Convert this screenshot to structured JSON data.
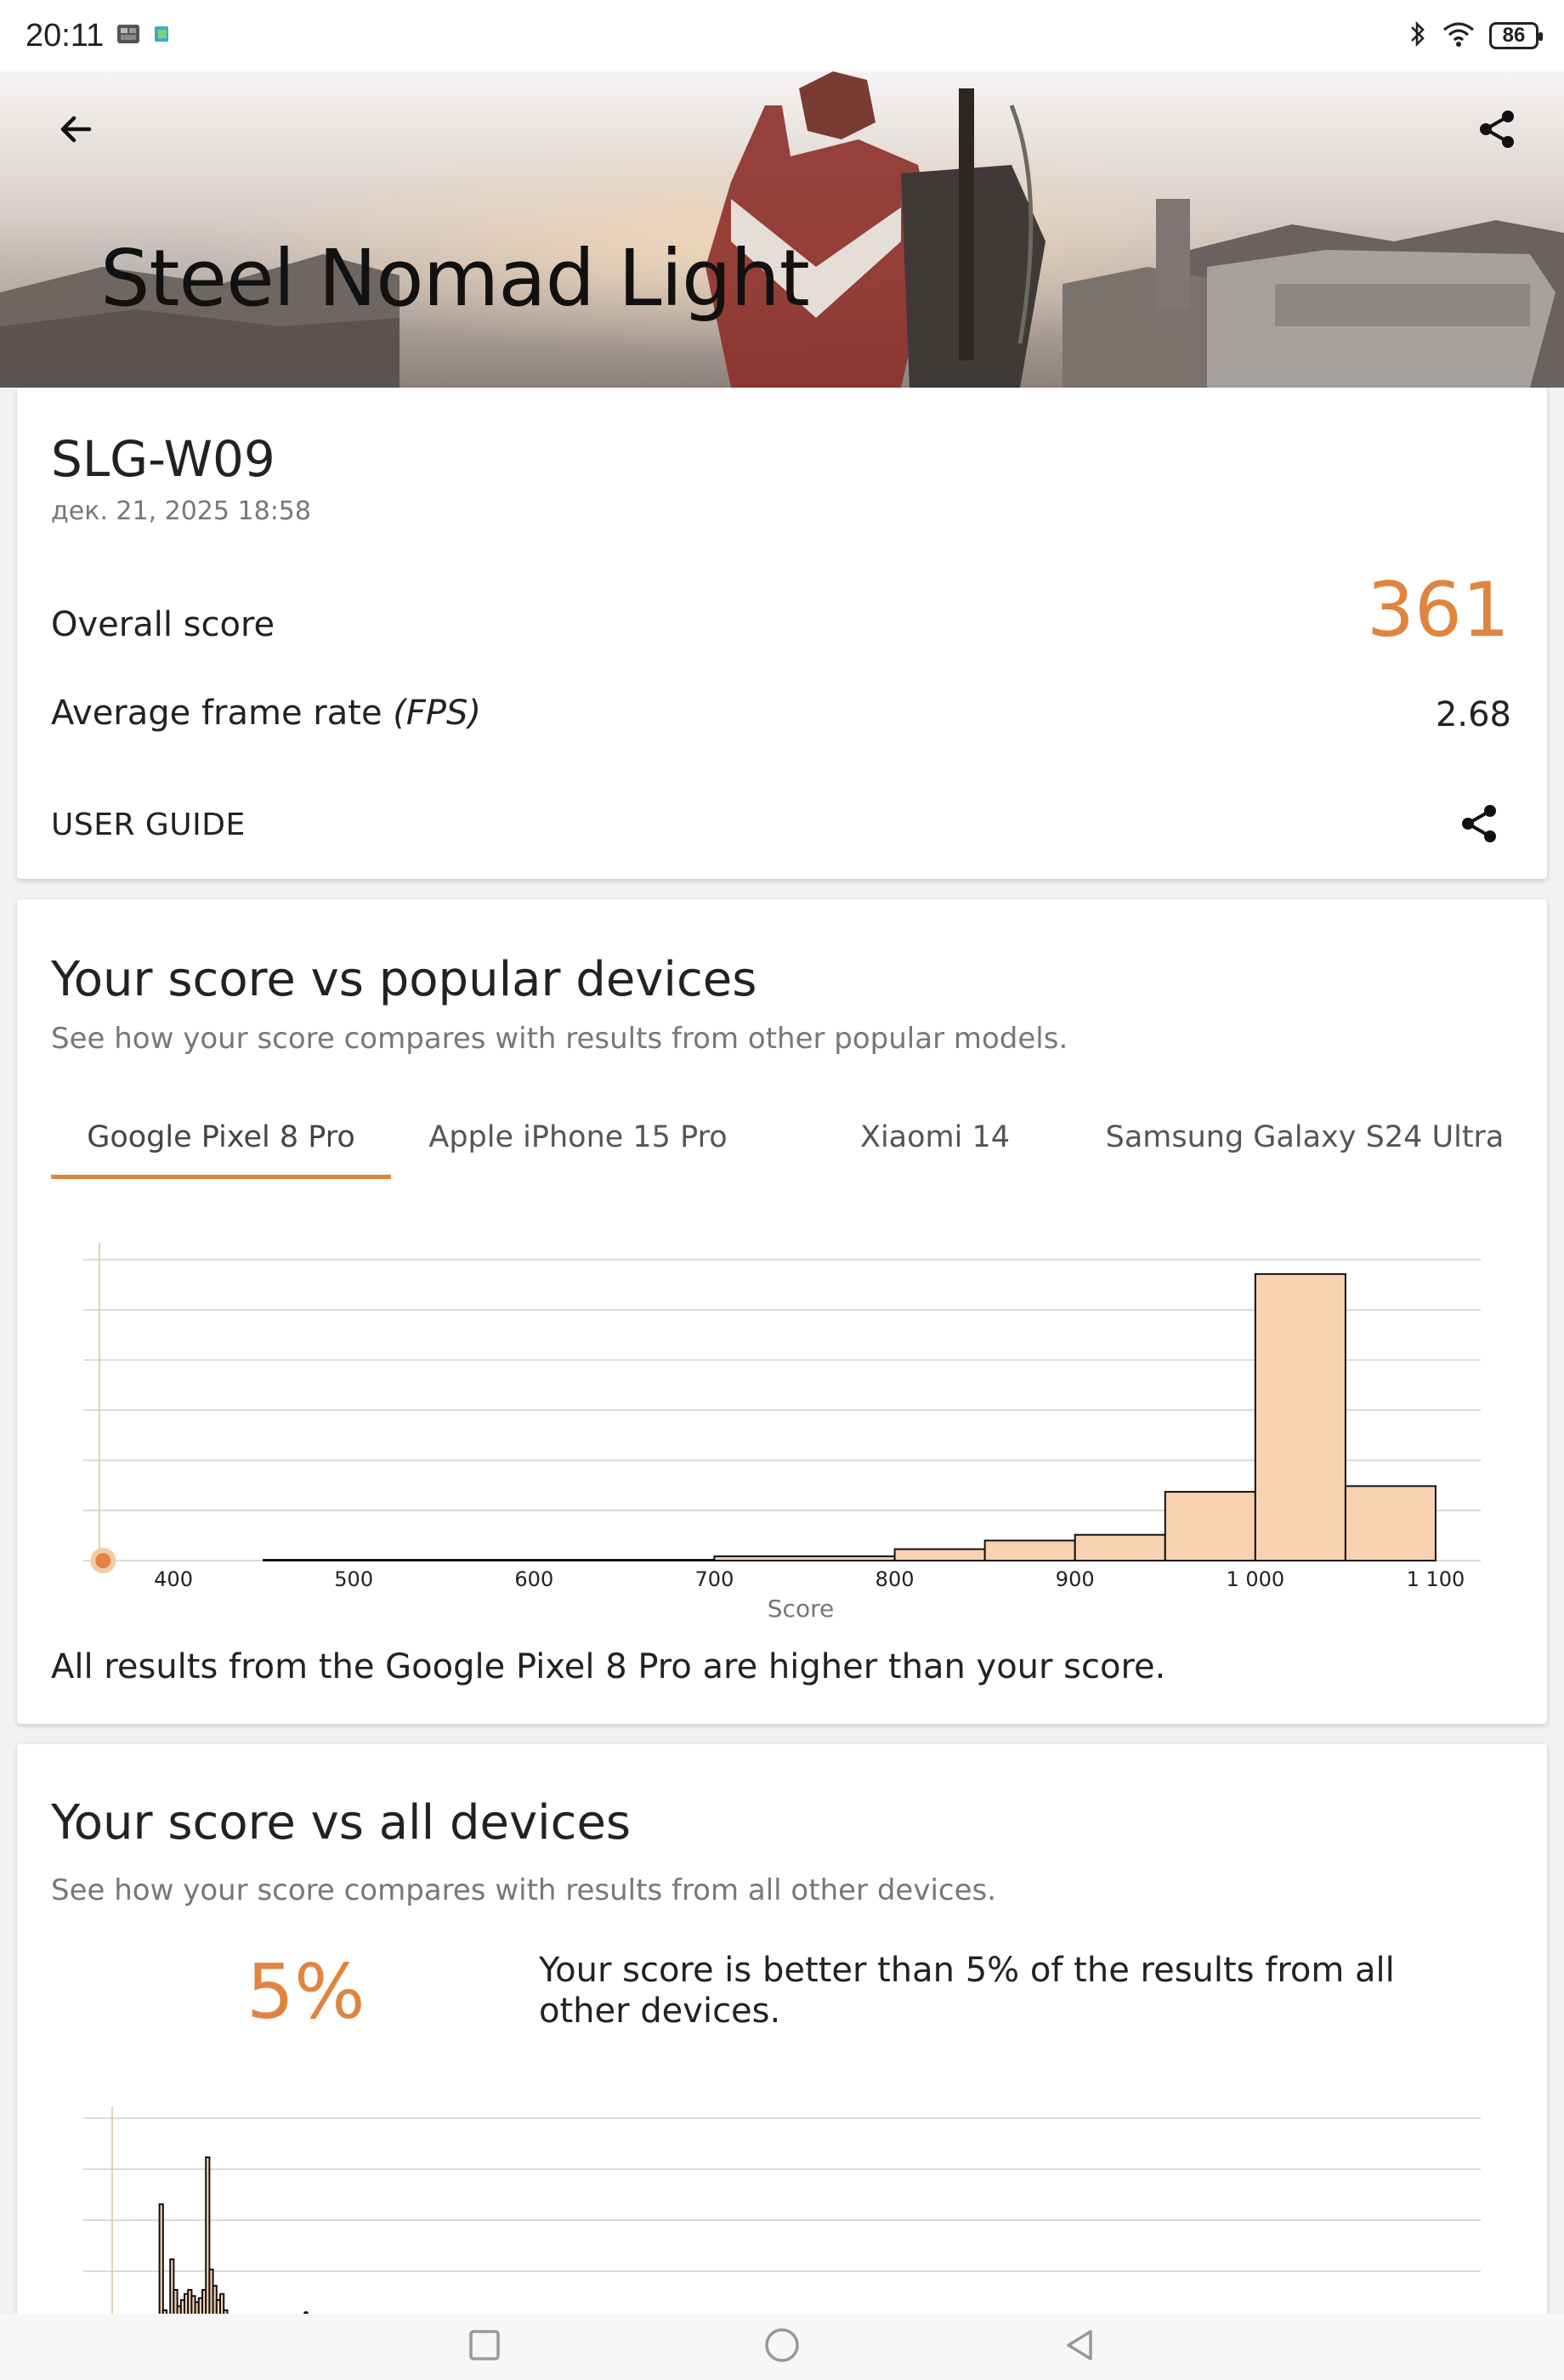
{
  "status_bar": {
    "time": "20:11",
    "battery": "86"
  },
  "header": {
    "title": "Steel Nomad Light"
  },
  "result_card": {
    "device_name": "SLG-W09",
    "date": "дек. 21, 2025 18:58",
    "overall_score_label": "Overall score",
    "overall_score_value": "361",
    "fps_label": "Average frame rate",
    "fps_unit": "(FPS)",
    "fps_value": "2.68",
    "user_guide_label": "USER GUIDE"
  },
  "popular_section": {
    "title": "Your score vs popular devices",
    "subtitle": "See how your score compares with results from other popular models.",
    "tabs": [
      {
        "label": "Google Pixel 8 Pro",
        "active": true
      },
      {
        "label": "Apple iPhone 15 Pro",
        "active": false
      },
      {
        "label": "Xiaomi 14",
        "active": false
      },
      {
        "label": "Samsung Galaxy S24 Ultra",
        "active": false
      }
    ],
    "verdict": "All results from the Google Pixel 8 Pro are higher than your score."
  },
  "all_section": {
    "title": "Your score vs all devices",
    "subtitle": "See how your score compares with results from all other devices.",
    "percentile": "5%",
    "percentile_text": "Your score is better than 5% of the results from all other devices."
  },
  "colors": {
    "accent": "#e0843f",
    "bar_fill": "#f8d2b0",
    "grid": "#cfcfcf"
  },
  "chart_data": [
    {
      "type": "bar",
      "title": "",
      "xlabel": "Score",
      "ylabel": "",
      "x_ticks": [
        "400",
        "500",
        "600",
        "700",
        "800",
        "900",
        "1 000",
        "1 100"
      ],
      "xlim": [
        350,
        1125
      ],
      "grid": true,
      "your_score": 361,
      "bins": [
        {
          "from": 450,
          "to": 700,
          "value": 0.003
        },
        {
          "from": 700,
          "to": 800,
          "value": 0.015
        },
        {
          "from": 800,
          "to": 850,
          "value": 0.04
        },
        {
          "from": 850,
          "to": 900,
          "value": 0.07
        },
        {
          "from": 900,
          "to": 950,
          "value": 0.09
        },
        {
          "from": 950,
          "to": 1000,
          "value": 0.24
        },
        {
          "from": 1000,
          "to": 1050,
          "value": 1.0
        },
        {
          "from": 1050,
          "to": 1100,
          "value": 0.26
        }
      ],
      "ylim": [
        0,
        1.05
      ]
    },
    {
      "type": "bar",
      "title": "",
      "xlabel": "",
      "ylabel": "",
      "grid": true,
      "xlim": [
        0,
        1000
      ],
      "bins_values": [
        0,
        0,
        0.05,
        0.62,
        0.1,
        0.0,
        0.35,
        0.2,
        0.12,
        0.15,
        0.18,
        0.2,
        0.17,
        0.14,
        0.16,
        0.2,
        0.85,
        0.3,
        0.22,
        0.15,
        0.18,
        0.1,
        0.05,
        0,
        0,
        0,
        0.02
      ],
      "bins_start": 25,
      "bin_width": 4,
      "ylim": [
        0,
        1.0
      ]
    }
  ]
}
